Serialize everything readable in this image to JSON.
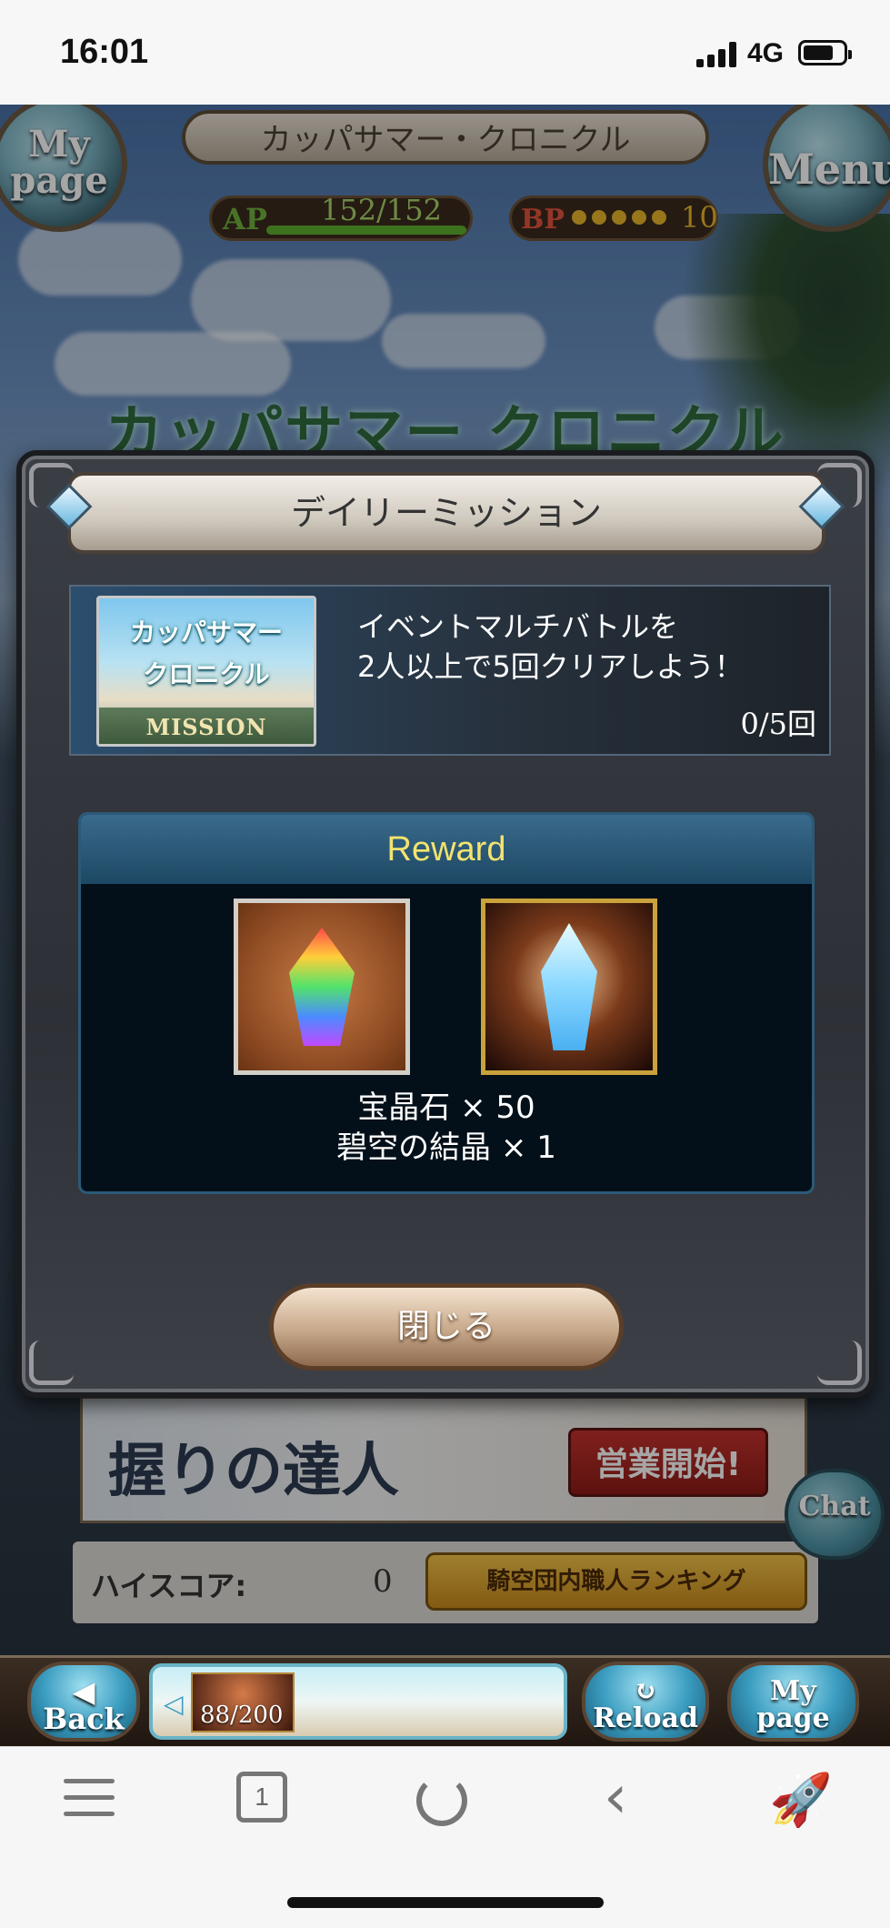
{
  "status_bar": {
    "time": "16:01",
    "network": "4G"
  },
  "game_header": {
    "title": "カッパサマー・クロニクル",
    "mypage_button": "My page",
    "menu_button": "Menu",
    "ap_label": "AP",
    "ap_value": "152/152",
    "bp_label": "BP",
    "bp_value": "10",
    "event_banner_title": "カッパサマー クロニクル"
  },
  "dialog": {
    "title": "デイリーミッション",
    "mission": {
      "thumb_line1": "カッパサマー",
      "thumb_line2": "クロニクル",
      "thumb_line3": "MISSION",
      "text_line1": "イベントマルチバトルを",
      "text_line2": "2人以上で5回クリアしよう！",
      "progress": "0/5回"
    },
    "reward": {
      "heading": "Reward",
      "item1_name": "宝晶石 × 50",
      "item2_name": "碧空の結晶 × 1"
    },
    "close_button": "閉じる"
  },
  "background_page": {
    "banner_text": "握りの達人",
    "banner_button": "営業開始!",
    "highscore_label": "ハイスコア:",
    "highscore_value": "0",
    "ranking_button": "騎空団内職人ランキング",
    "chat_button": "Chat"
  },
  "game_nav": {
    "back_button": "Back",
    "center_counter": "88/200",
    "reload_button": "Reload",
    "mypage_button": "My page"
  },
  "browser_toolbar": {
    "tab_count": "1"
  }
}
